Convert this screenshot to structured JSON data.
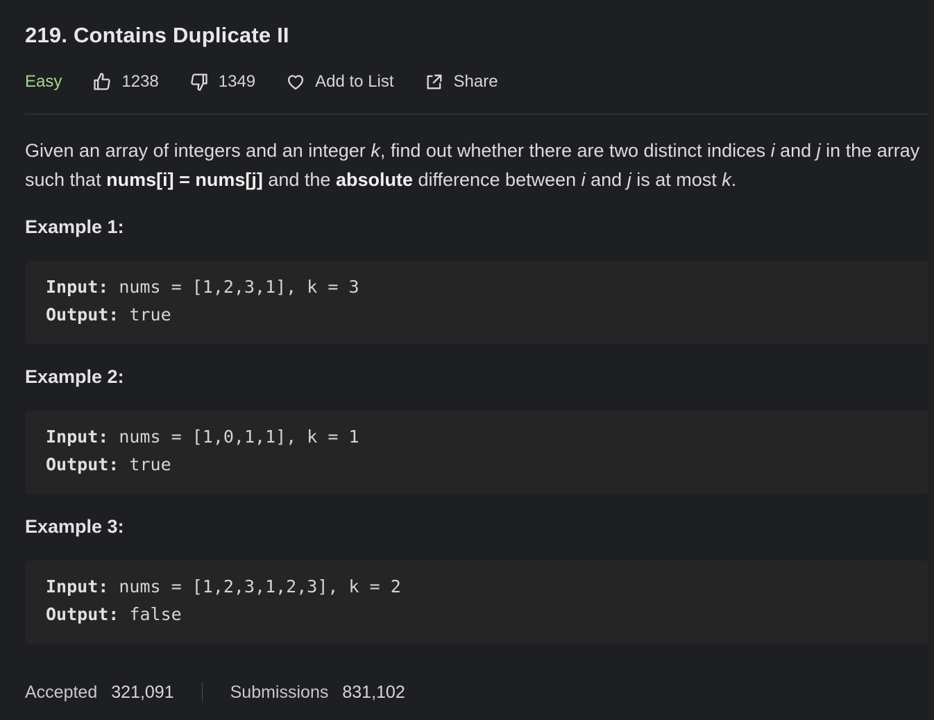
{
  "problem": {
    "title": "219. Contains Duplicate II",
    "difficulty": "Easy",
    "likes": "1238",
    "dislikes": "1349",
    "add_to_list": "Add to List",
    "share": "Share"
  },
  "description": {
    "p1": "Given an array of integers and an integer ",
    "k1": "k",
    "p2": ", find out whether there are two distinct indices ",
    "i1": "i",
    "p3": " and ",
    "j1": "j",
    "p4": " in the array such that ",
    "b1": "nums[i] = nums[j]",
    "p5": " and the ",
    "b2": "absolute",
    "p6": " difference between ",
    "i2": "i",
    "p7": " and ",
    "j2": "j",
    "p8": " is at most ",
    "k2": "k",
    "p9": "."
  },
  "examples": [
    {
      "title": "Example 1:",
      "input_label": "Input:",
      "input": " nums = [1,2,3,1], k = 3",
      "output_label": "Output:",
      "output": " true"
    },
    {
      "title": "Example 2:",
      "input_label": "Input:",
      "input": " nums = [1,0,1,1], k = 1",
      "output_label": "Output:",
      "output": " true"
    },
    {
      "title": "Example 3:",
      "input_label": "Input:",
      "input": " nums = [1,2,3,1,2,3], k = 2",
      "output_label": "Output:",
      "output": " false"
    }
  ],
  "stats": {
    "accepted_label": "Accepted",
    "accepted": "321,091",
    "submissions_label": "Submissions",
    "submissions": "831,102"
  },
  "colors": {
    "easy": "#a8d58a",
    "background": "#1e1f22",
    "code_background": "#252526"
  },
  "icons": {
    "like": "thumbs-up-icon",
    "dislike": "thumbs-down-icon",
    "add_to_list": "heart-icon",
    "share": "share-icon"
  }
}
